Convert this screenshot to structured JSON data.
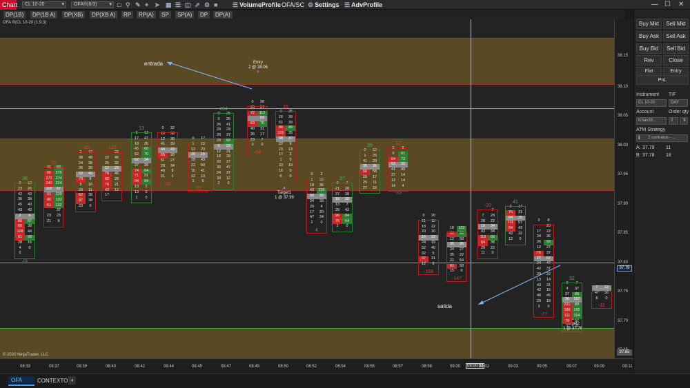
{
  "top": {
    "chart_tag": "Chart",
    "instrument_select": "CL 10-20",
    "indicator_select": "OFA®(8/3)",
    "buttons": [
      "VolumeProfile",
      "OFA/SC",
      "Settings",
      "AdvProfile"
    ],
    "window_controls": [
      "—",
      "☐",
      "✕"
    ]
  },
  "tabs_row": [
    "DP(1B)",
    "DP(1B A)",
    "DP(XB)",
    "DP(XB A)",
    "RP",
    "RP(A)",
    "SP",
    "SP(A)",
    "DP",
    "DP(A)"
  ],
  "right_collapse": "F",
  "chart": {
    "label": "OFA ®(CL 10-20 (1,9,3)",
    "copyright": "© 2020 NinjaTrader, LLC",
    "annotations": {
      "entrada": "entrada",
      "salida": "salida",
      "entry_title": "Entry",
      "entry_price": "2 @ 38.06",
      "target1_title": "Target1",
      "target1_price": "1 @ 37.99",
      "target2_title": "Target2",
      "target2_price": "1 @ 37.76"
    },
    "price_labels": [
      "38.15",
      "38.10",
      "38.05",
      "38.00",
      "37.95",
      "37.90",
      "37.85",
      "37.80",
      "37.75",
      "37.70",
      "37.65"
    ],
    "current_price": "37.79",
    "low_price": "37.65",
    "time_labels": [
      "08:33",
      "08:37",
      "08:39",
      "08:40",
      "08:42",
      "08:44",
      "08:45",
      "08:47",
      "08:49",
      "08:50",
      "08:52",
      "08:54",
      "08:55",
      "08:57",
      "08:58",
      "09:00",
      "09:00:03",
      "09:01",
      "09:03",
      "09:05",
      "09:07",
      "09:09",
      "09:11",
      "09:12"
    ],
    "bars": [
      {
        "top": "36",
        "top_color": "#4caf50",
        "bottom": "75",
        "bottom_color": "#4caf50",
        "rows": [
          [
            "0",
            "12"
          ],
          [
            "23",
            "26"
          ],
          [
            "42",
            "43"
          ],
          [
            "36",
            "38"
          ],
          [
            "45",
            "40"
          ],
          [
            "43",
            "42"
          ],
          [
            "2",
            "6"
          ],
          [
            "80",
            "87"
          ],
          [
            "60",
            "38"
          ],
          [
            "108",
            "44"
          ],
          [
            "61",
            "68"
          ],
          [
            "28",
            "16"
          ],
          [
            "4",
            "0"
          ],
          [
            "0",
            ""
          ]
        ]
      },
      {
        "top": "15",
        "top_color": "#e53935",
        "bottom": "",
        "bottom_color": "#e53935",
        "rows": [
          [
            "36",
            "88"
          ],
          [
            "65",
            "279"
          ],
          [
            "272",
            "274"
          ],
          [
            "240",
            "224"
          ],
          [
            "115",
            "67"
          ],
          [
            "91",
            "129"
          ],
          [
            "86",
            "133"
          ],
          [
            "61",
            "132"
          ],
          [
            "",
            "37"
          ],
          [
            "23",
            "23"
          ],
          [
            "21",
            "9"
          ]
        ]
      },
      {
        "top": "-30",
        "top_color": "#e53935",
        "bottom": "",
        "bottom_color": "#e53935",
        "rows": [
          [
            "2",
            "47"
          ],
          [
            "38",
            "48"
          ],
          [
            "24",
            "38"
          ],
          [
            "26",
            "30"
          ],
          [
            "93",
            "49"
          ],
          [
            "79",
            "8"
          ],
          [
            "5",
            "16"
          ],
          [
            "20",
            "11"
          ],
          [
            "62",
            "38"
          ],
          [
            "87",
            "38"
          ],
          [
            "23",
            "0"
          ]
        ]
      },
      {
        "top": "-122",
        "top_color": "#e53935",
        "bottom": "",
        "bottom_color": "#e53935",
        "rows": [
          [
            "",
            "23"
          ],
          [
            "22",
            "46"
          ],
          [
            "25",
            "32"
          ],
          [
            "12",
            "29"
          ],
          [
            "76",
            "46"
          ],
          [
            "60",
            "28"
          ],
          [
            "76",
            "21"
          ],
          [
            "43",
            "12"
          ],
          [
            "17",
            ""
          ]
        ]
      },
      {
        "top": "13",
        "top_color": "#4caf50",
        "bottom": "",
        "bottom_color": "#4caf50",
        "rows": [
          [
            "0",
            "13"
          ],
          [
            "17",
            "47"
          ],
          [
            "18",
            "35"
          ],
          [
            "45",
            "60"
          ],
          [
            "52",
            "70"
          ],
          [
            "62",
            "34"
          ],
          [
            "37",
            "36"
          ],
          [
            "74",
            "64"
          ],
          [
            "71",
            "31"
          ],
          [
            "84",
            "84"
          ],
          [
            "13",
            "2"
          ],
          [
            "13",
            "0"
          ],
          [
            "1",
            "0"
          ]
        ]
      },
      {
        "top": "",
        "top_color": "#e53935",
        "bottom": "-35",
        "bottom_color": "#e53935",
        "rows": [
          [
            "0",
            "32"
          ],
          [
            "10",
            "38"
          ],
          [
            "12",
            "38"
          ],
          [
            "41",
            "39"
          ],
          [
            "44",
            "49"
          ],
          [
            "65",
            "28"
          ],
          [
            "51",
            "27"
          ],
          [
            "20",
            "34"
          ],
          [
            "40",
            "8"
          ],
          [
            "21",
            "1"
          ]
        ]
      },
      {
        "top": "",
        "top_color": "#e53935",
        "bottom": "-77",
        "bottom_color": "#e53935",
        "rows": [
          [
            "0",
            "17"
          ],
          [
            "5",
            "28"
          ],
          [
            "12",
            "23"
          ],
          [
            "20",
            "16"
          ],
          [
            "18",
            "43"
          ],
          [
            "22",
            "50"
          ],
          [
            "10",
            "41"
          ],
          [
            "12",
            "13"
          ],
          [
            "1",
            "5"
          ]
        ]
      },
      {
        "top": "204",
        "top_color": "#4caf50",
        "bottom": "",
        "bottom_color": "#4caf50",
        "rows": [
          [
            "0",
            "25"
          ],
          [
            "0",
            "26"
          ],
          [
            "26",
            "41"
          ],
          [
            "29",
            "29"
          ],
          [
            "20",
            "37"
          ],
          [
            "29",
            "60"
          ],
          [
            "0",
            "23"
          ],
          [
            "12",
            "31"
          ],
          [
            "18",
            "28"
          ],
          [
            "32",
            "27"
          ],
          [
            "30",
            "47"
          ],
          [
            "24",
            "37"
          ],
          [
            "30",
            "12"
          ],
          [
            "2",
            "0"
          ]
        ]
      },
      {
        "top": "",
        "top_color": "#e53935",
        "bottom": "-64",
        "bottom_color": "#e53935",
        "rows": [
          [
            "0",
            "28"
          ],
          [
            "20",
            "57"
          ],
          [
            "72",
            "112"
          ],
          [
            "",
            "83"
          ],
          [
            "63",
            "70"
          ],
          [
            "40",
            "31"
          ],
          [
            "36",
            "17"
          ],
          [
            "23",
            "7"
          ],
          [
            "3",
            "0"
          ]
        ]
      },
      {
        "top": "15",
        "top_color": "#e53935",
        "bottom": "",
        "bottom_color": "#e53935",
        "rows": [
          [
            "0",
            "35"
          ],
          [
            "16",
            "39"
          ],
          [
            "51",
            "39"
          ],
          [
            "88",
            "88"
          ],
          [
            "101",
            "35"
          ],
          [
            "98",
            "37"
          ],
          [
            "22",
            "9"
          ],
          [
            "23",
            "13"
          ],
          [
            "17",
            "2"
          ],
          [
            "1",
            "0"
          ],
          [
            "23",
            "19"
          ],
          [
            "16",
            "0"
          ],
          [
            "6",
            "0"
          ]
        ]
      },
      {
        "top": "",
        "top_color": "#e53935",
        "bottom": "4",
        "bottom_color": "#4caf50",
        "rows": [
          [
            "0",
            "2"
          ],
          [
            "2",
            "30"
          ],
          [
            "18",
            "36"
          ],
          [
            "43",
            "155"
          ],
          [
            "50",
            "30"
          ],
          [
            "34",
            "33"
          ],
          [
            "29",
            "4"
          ],
          [
            "17",
            "20"
          ],
          [
            "47",
            "34"
          ],
          [
            "2",
            "0"
          ]
        ]
      },
      {
        "top": "37",
        "top_color": "#4caf50",
        "bottom": "",
        "bottom_color": "#4caf50",
        "rows": [
          [
            "0",
            "7"
          ],
          [
            "21",
            "28"
          ],
          [
            "37",
            "28"
          ],
          [
            "18",
            "28"
          ],
          [
            "13",
            "7"
          ],
          [
            "29",
            "42"
          ],
          [
            "96",
            "84"
          ],
          [
            "75",
            "64"
          ],
          [
            "2",
            "0"
          ]
        ]
      },
      {
        "top": "39",
        "top_color": "#4caf50",
        "bottom": "",
        "bottom_color": "#4caf50",
        "rows": [
          [
            "0",
            "12"
          ],
          [
            "1",
            "25"
          ],
          [
            "41",
            "29"
          ],
          [
            "35",
            "35"
          ],
          [
            "66",
            "58"
          ],
          [
            "29",
            "17"
          ],
          [
            "25",
            "11"
          ],
          [
            "27",
            "19"
          ]
        ]
      },
      {
        "top": "12",
        "top_color": "#e53935",
        "bottom": "-33",
        "bottom_color": "#e53935",
        "rows": [
          [
            "0",
            "8"
          ],
          [
            "0",
            "91"
          ],
          [
            "64",
            "73"
          ],
          [
            "53",
            "30"
          ],
          [
            "41",
            "49"
          ],
          [
            "37",
            "14"
          ],
          [
            "12",
            "14"
          ],
          [
            "14",
            "4"
          ]
        ]
      },
      {
        "top": "",
        "top_color": "#e53935",
        "bottom": "-168",
        "bottom_color": "#e53935",
        "rows": [
          [
            "0",
            "20"
          ],
          [
            "21",
            "18"
          ],
          [
            "18",
            "22"
          ],
          [
            "20",
            "20"
          ],
          [
            "16",
            "22"
          ],
          [
            "24",
            "19"
          ],
          [
            "52",
            "40"
          ],
          [
            "32",
            "5"
          ],
          [
            "87",
            "31"
          ],
          [
            "12",
            "9"
          ]
        ]
      },
      {
        "top": "",
        "top_color": "#e53935",
        "bottom": "-147",
        "bottom_color": "#e53935",
        "rows": [
          [
            "18",
            "122"
          ],
          [
            "93",
            "96"
          ],
          [
            "12",
            "58"
          ],
          [
            "35",
            "35"
          ],
          [
            "24",
            "27"
          ],
          [
            "35",
            "22"
          ],
          [
            "22",
            "54"
          ],
          [
            "81",
            "58"
          ],
          [
            "15",
            "0"
          ]
        ]
      },
      {
        "top": "-20",
        "top_color": "#e53935",
        "bottom": "",
        "bottom_color": "#e53935",
        "rows": [
          [
            "",
            "7"
          ],
          [
            "7",
            "28"
          ],
          [
            "28",
            "22"
          ],
          [
            "10",
            "34"
          ],
          [
            "43",
            "34"
          ],
          [
            "118",
            "88"
          ],
          [
            "84",
            "38"
          ],
          [
            "29",
            "22"
          ],
          [
            "11",
            "0"
          ]
        ]
      },
      {
        "top": "41",
        "top_color": "#4caf50",
        "bottom": "",
        "bottom_color": "#4caf50",
        "rows": [
          [
            "2",
            "17"
          ],
          [
            "76",
            "31"
          ],
          [
            "64",
            "25"
          ],
          [
            "111",
            "57"
          ],
          [
            "84",
            "43"
          ],
          [
            "43",
            "32"
          ],
          [
            "12",
            "0"
          ]
        ]
      },
      {
        "top": "",
        "top_color": "#e53935",
        "bottom": "-77",
        "bottom_color": "#e53935",
        "rows": [
          [
            "2",
            "8"
          ],
          [
            "",
            "28"
          ],
          [
            "17",
            "22"
          ],
          [
            "34",
            "36"
          ],
          [
            "26",
            "60"
          ],
          [
            "12",
            "27"
          ],
          [
            "76",
            "37"
          ],
          [
            "27",
            "57"
          ],
          [
            "24",
            "47"
          ],
          [
            "42",
            "37"
          ],
          [
            "29",
            "22"
          ],
          [
            "13",
            "14"
          ],
          [
            "43",
            "31"
          ],
          [
            "42",
            "16"
          ],
          [
            "48",
            "45"
          ],
          [
            "29",
            "18"
          ],
          [
            "3",
            "0"
          ]
        ]
      },
      {
        "top": "92",
        "top_color": "#4caf50",
        "bottom": "",
        "bottom_color": "#4caf50",
        "rows": [
          [
            "0",
            "7"
          ],
          [
            "4",
            "37"
          ],
          [
            "37",
            "89"
          ],
          [
            "36",
            "157"
          ],
          [
            "231",
            "89"
          ],
          [
            "188",
            "192"
          ],
          [
            "111",
            "154"
          ],
          [
            "79",
            "57"
          ],
          [
            "1",
            "0"
          ]
        ]
      },
      {
        "top": "",
        "top_color": "#e53935",
        "bottom": "-11",
        "bottom_color": "#e53935",
        "rows": [
          [
            "7",
            "12"
          ],
          [
            "47",
            "30"
          ],
          [
            "6",
            "0"
          ]
        ]
      }
    ]
  },
  "panel": {
    "buttons": [
      [
        "Buy Mkt",
        "Sell Mkt"
      ],
      [
        "Buy Ask",
        "Sell Ask"
      ],
      [
        "Buy Bid",
        "Sell Bid"
      ],
      [
        "Rev",
        "Close"
      ]
    ],
    "flat": "Flat",
    "entry": "Entry",
    "pnl": "PnL",
    "instrument_label": "Instrument",
    "tif_label": "TIF",
    "instrument": "CL 10-20",
    "tif": "DAY",
    "account_label": "Account",
    "qty_label": "Order qty",
    "account": "fchav33...",
    "qty": "2",
    "atm_label": "ATM Strategy",
    "atm": "2 contratos - ...",
    "ask_label": "A:",
    "ask_price": "37.79",
    "ask_size": "11",
    "bid_label": "B:",
    "bid_price": "37.78",
    "bid_size": "18"
  },
  "bottom": {
    "tabs": [
      "OFA",
      "CONTEXTO"
    ],
    "add": "+"
  },
  "colors": {
    "accent": "#c8102e",
    "buy": "#4caf50",
    "sell": "#e53935",
    "zone": "#5a4a23",
    "blue_line": "#6fa0ff"
  }
}
